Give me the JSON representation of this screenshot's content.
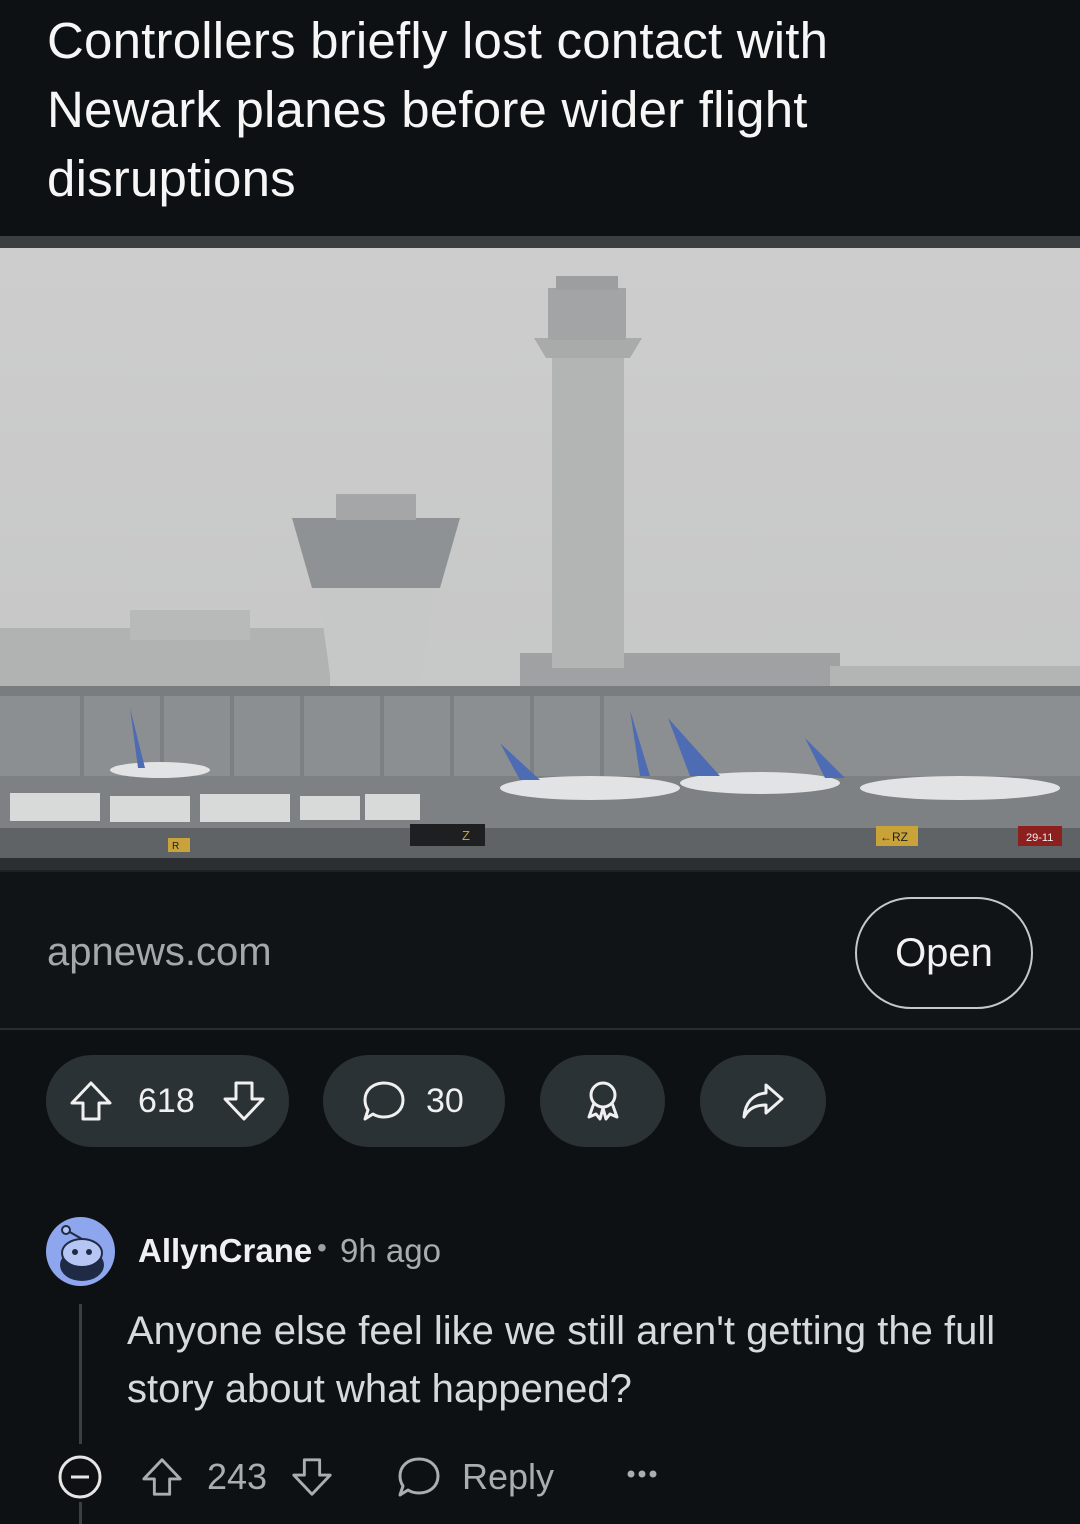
{
  "post": {
    "title": "Controllers briefly lost contact with Newark planes before wider flight disruptions",
    "image_alt": "Foggy airport with control towers and parked planes",
    "image_signs": [
      "Z",
      "R",
      "←RZ",
      "29-11"
    ],
    "link_domain": "apnews.com",
    "open_label": "Open"
  },
  "actions": {
    "vote_count": "618",
    "comment_count": "30",
    "upvote_icon": "arrow-up-icon",
    "downvote_icon": "arrow-down-icon",
    "comment_icon": "speech-bubble-icon",
    "award_icon": "award-icon",
    "share_icon": "share-arrow-icon"
  },
  "comment": {
    "author": "AllynCrane",
    "separator": "•",
    "time": "9h ago",
    "body": "Anyone else feel like we still aren't getting the full story about what happened?",
    "vote_count": "243",
    "reply_label": "Reply",
    "more_label": "•••"
  },
  "colors": {
    "background": "#0e1113",
    "pill": "#2a3236",
    "avatar": "#8da6ee",
    "muted_text": "#a7acaf"
  }
}
